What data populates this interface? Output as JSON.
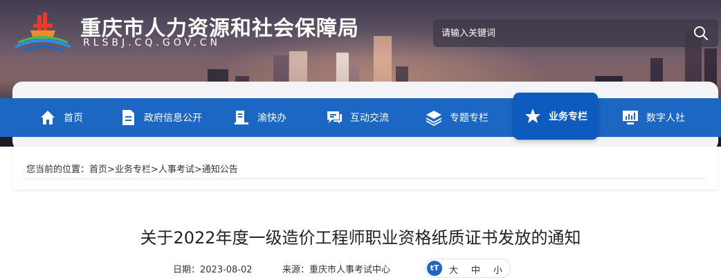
{
  "header": {
    "site_title": "重庆市人力资源和社会保障局",
    "site_domain": "RLSBJ.CQ.GOV.CN",
    "search_placeholder": "请输入关键词"
  },
  "nav": {
    "items": [
      {
        "label": "首页",
        "icon": "home-icon"
      },
      {
        "label": "政府信息公开",
        "icon": "document-icon"
      },
      {
        "label": "渝快办",
        "icon": "service-icon"
      },
      {
        "label": "互动交流",
        "icon": "chat-icon"
      },
      {
        "label": "专题专栏",
        "icon": "layers-icon"
      },
      {
        "label": "业务专栏",
        "icon": "star-icon",
        "active": true
      },
      {
        "label": "数字人社",
        "icon": "monitor-icon"
      }
    ]
  },
  "breadcrumb": {
    "prefix": "您当前的位置：",
    "items": [
      "首页",
      "业务专栏",
      "人事考试",
      "通知公告"
    ],
    "separator": ">"
  },
  "article": {
    "title": "关于2022年度一级造价工程师职业资格纸质证书发放的通知",
    "date_label": "日期：",
    "date": "2023-08-02",
    "source_label": "来源：",
    "source": "重庆市人事考试中心",
    "font_sizes": [
      "大",
      "中",
      "小"
    ]
  },
  "colors": {
    "nav_bg": "#1b67c3",
    "nav_active": "#0e5bbf"
  }
}
